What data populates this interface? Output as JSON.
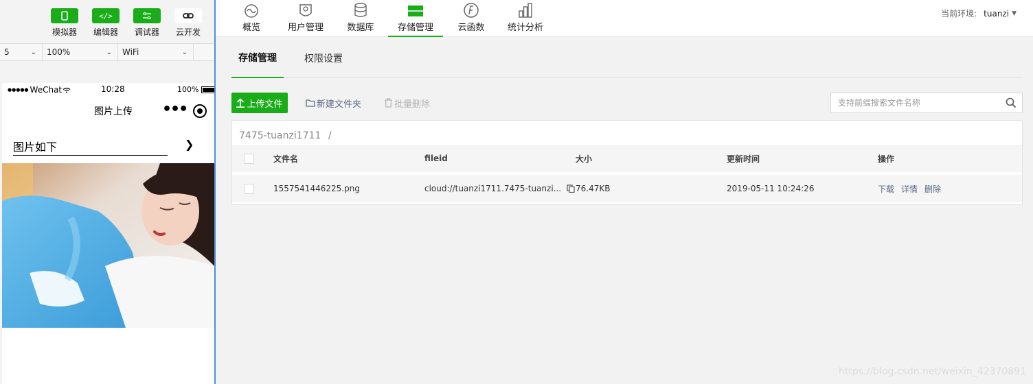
{
  "simulator": {
    "toolbar": [
      {
        "label": "模拟器",
        "icon": "phone-icon"
      },
      {
        "label": "编辑器",
        "icon": "code-icon"
      },
      {
        "label": "调试器",
        "icon": "sliders-icon"
      },
      {
        "label": "云开发",
        "icon": "link-icon"
      }
    ],
    "selects": {
      "device": "5",
      "zoom": "100%",
      "network": "WiFi"
    },
    "status_bar": {
      "carrier": "WeChat",
      "time": "10:28",
      "battery": "100%"
    },
    "page_title": "图片上传",
    "picture_row_label": "图片如下"
  },
  "console": {
    "nav": [
      {
        "label": "概览",
        "icon": "overview-icon"
      },
      {
        "label": "用户管理",
        "icon": "users-icon"
      },
      {
        "label": "数据库",
        "icon": "database-icon"
      },
      {
        "label": "存储管理",
        "icon": "storage-icon"
      },
      {
        "label": "云函数",
        "icon": "cloud-function-icon"
      },
      {
        "label": "统计分析",
        "icon": "statistics-icon"
      }
    ],
    "active_nav": "存储管理",
    "env_label": "当前环境:",
    "env_value": "tuanzi",
    "subtabs": [
      "存储管理",
      "权限设置"
    ],
    "toolbar": {
      "upload": "上传文件",
      "new_folder": "新建文件夹",
      "batch_delete": "批量删除",
      "search_placeholder": "支持前缀搜索文件名称"
    },
    "path": {
      "root": "7475-tuanzi1711",
      "separator": "/"
    },
    "table": {
      "headers": {
        "name": "文件名",
        "fileid": "fileid",
        "size": "大小",
        "updated": "更新时间",
        "actions": "操作"
      },
      "rows": [
        {
          "name": "1557541446225.png",
          "fileid": "cloud://tuanzi1711.7475-tuanzi...",
          "size": "76.47KB",
          "updated": "2019-05-11 10:24:26",
          "actions": [
            "下载",
            "详情",
            "删除"
          ]
        }
      ]
    },
    "watermark": "https://blog.csdn.net/weixin_42370891"
  },
  "colors": {
    "accent": "#1aad19",
    "link": "#5b6987",
    "divider": "#4a90d9"
  }
}
